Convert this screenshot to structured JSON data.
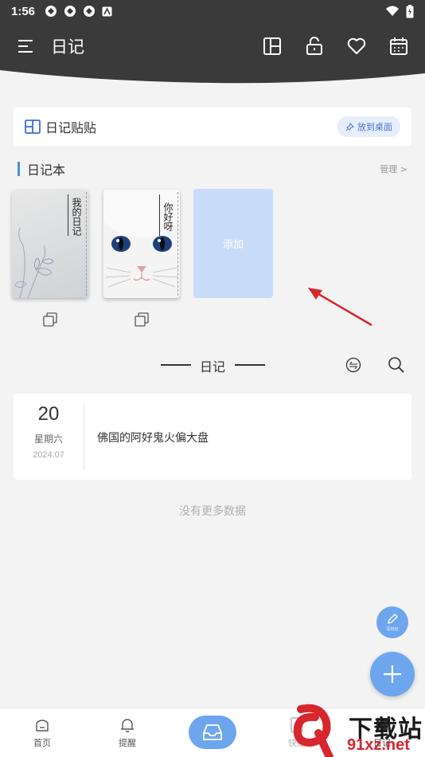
{
  "statusbar": {
    "time": "1:56"
  },
  "header": {
    "title": "日记"
  },
  "sticker": {
    "label": "日记贴贴",
    "pin_button": "放到桌面"
  },
  "notebooks": {
    "section_title": "日记本",
    "manage_link": "管理 >",
    "items": [
      {
        "spine": "我的日记"
      },
      {
        "spine": "你好呀"
      }
    ],
    "add_label": "添加"
  },
  "diary": {
    "section_title": "日记",
    "entries": [
      {
        "day": "20",
        "weekday": "星期六",
        "year_month": "2024.07",
        "text": "佛国的阿好鬼火偏大盘"
      }
    ],
    "no_more": "没有更多数据"
  },
  "fab": {
    "write_caption": "写日记"
  },
  "bottom_nav": {
    "items": [
      {
        "label": "首页"
      },
      {
        "label": "提醒"
      },
      {
        "label": "快账"
      },
      {
        "label": "日记"
      }
    ]
  },
  "watermark": {
    "text": "下载站",
    "site": "91xz.net"
  },
  "colors": {
    "header_bg": "#3a3a3a",
    "accent": "#6ea6ee",
    "add_tile": "#c8dcfa",
    "annotation_arrow": "#d7262e"
  }
}
